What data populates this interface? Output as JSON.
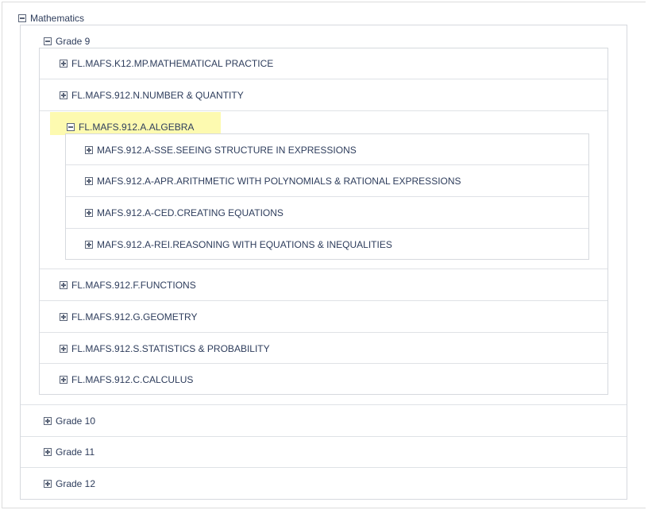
{
  "root": {
    "label": "Mathematics",
    "expanded": true
  },
  "grade9": {
    "label": "Grade 9",
    "expanded": true
  },
  "standards": [
    {
      "label": "FL.MAFS.K12.MP.MATHEMATICAL PRACTICE",
      "expanded": false
    },
    {
      "label": "FL.MAFS.912.N.NUMBER & QUANTITY",
      "expanded": false
    },
    {
      "label": "FL.MAFS.912.A.ALGEBRA",
      "expanded": true,
      "highlighted": true
    },
    {
      "label": "FL.MAFS.912.F.FUNCTIONS",
      "expanded": false
    },
    {
      "label": "FL.MAFS.912.G.GEOMETRY",
      "expanded": false
    },
    {
      "label": "FL.MAFS.912.S.STATISTICS & PROBABILITY",
      "expanded": false
    },
    {
      "label": "FL.MAFS.912.C.CALCULUS",
      "expanded": false
    }
  ],
  "algebra_children": [
    {
      "label": "MAFS.912.A-SSE.SEEING STRUCTURE IN EXPRESSIONS",
      "expanded": false
    },
    {
      "label": "MAFS.912.A-APR.ARITHMETIC WITH POLYNOMIALS & RATIONAL EXPRESSIONS",
      "expanded": false
    },
    {
      "label": "MAFS.912.A-CED.CREATING EQUATIONS",
      "expanded": false
    },
    {
      "label": "MAFS.912.A-REI.REASONING WITH EQUATIONS & INEQUALITIES",
      "expanded": false
    }
  ],
  "grades": [
    {
      "label": "Grade 10",
      "expanded": false
    },
    {
      "label": "Grade 11",
      "expanded": false
    },
    {
      "label": "Grade 12",
      "expanded": false
    }
  ],
  "colors": {
    "text": "#2e3d5c",
    "border": "#d6d9de",
    "highlight": "#fdfab0"
  }
}
